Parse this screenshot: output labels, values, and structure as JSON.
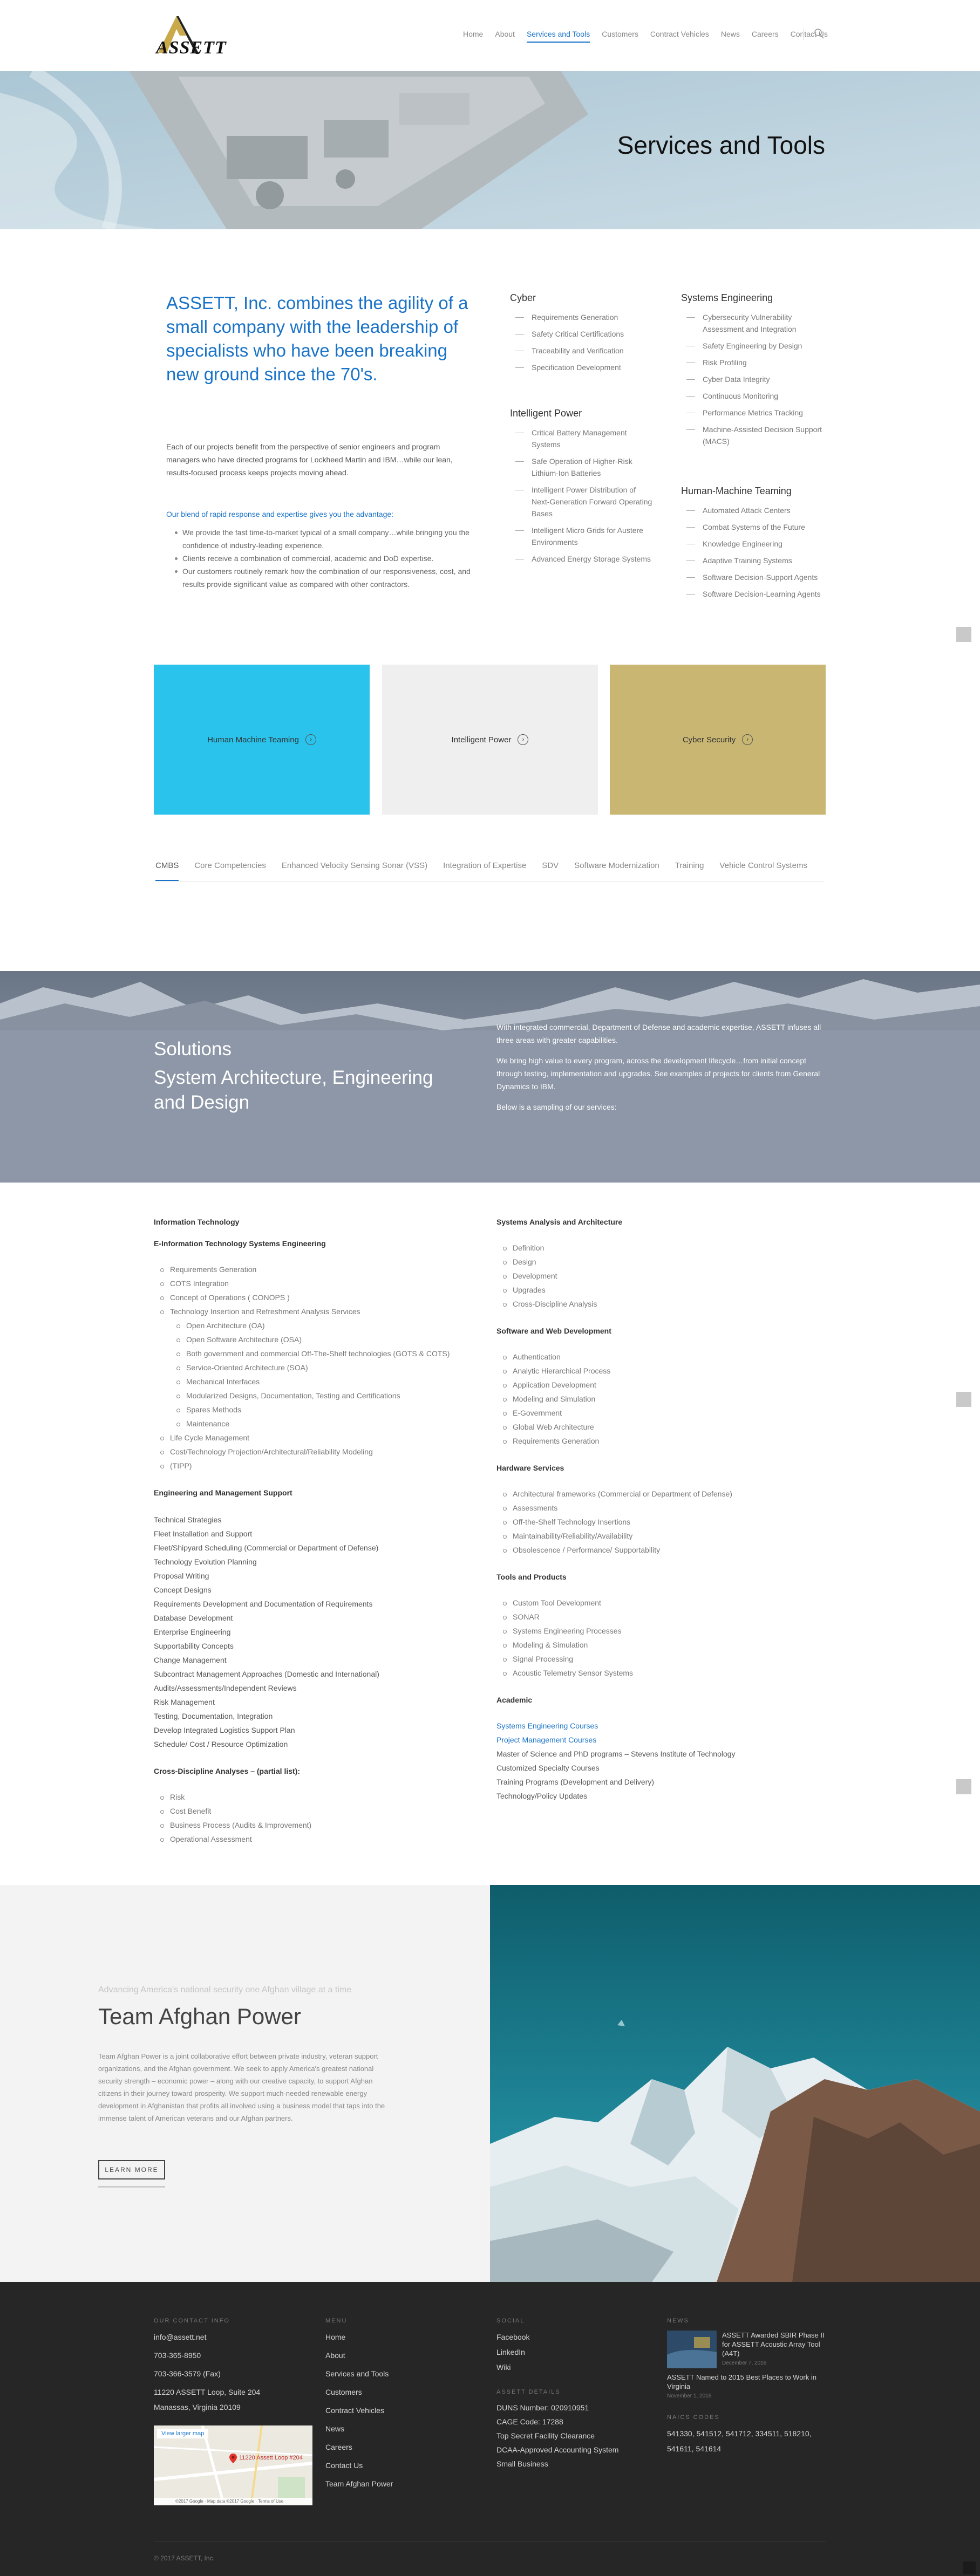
{
  "logo_text": "ASSETT",
  "nav": [
    "Home",
    "About",
    "Services and Tools",
    "Customers",
    "Contract Vehicles",
    "News",
    "Careers",
    "Contact Us"
  ],
  "hero_title": "Services and Tools",
  "intro": {
    "headline": "ASSETT, Inc. combines the agility of a small company with the leadership of specialists who have been breaking new ground since the 70's.",
    "para": "Each of our projects benefit from the perspective of senior engineers and program managers who have directed programs for Lockheed Martin and IBM…while our lean, results-focused process keeps projects moving ahead.",
    "sub": "Our blend of rapid response and expertise gives you the advantage:",
    "bullets": [
      "We provide the fast time-to-market typical of a small company…while bringing you the confidence of industry-leading experience.",
      "Clients receive a combination of commercial, academic and DoD expertise.",
      "Our customers routinely remark how the combination of our responsiveness, cost, and results provide significant value as compared with other contractors."
    ]
  },
  "services": {
    "cyber": {
      "title": "Cyber",
      "items": [
        "Requirements Generation",
        "Safety Critical Certifications",
        "Traceability and Verification",
        "Specification Development"
      ]
    },
    "power": {
      "title": "Intelligent Power",
      "items": [
        "Critical Battery Management Systems",
        "Safe Operation of Higher-Risk Lithium-Ion Batteries",
        "Intelligent Power Distribution of Next-Generation Forward Operating Bases",
        "Intelligent Micro Grids for Austere Environments",
        "Advanced Energy Storage Systems"
      ]
    },
    "systems": {
      "title": "Systems Engineering",
      "items": [
        "Cybersecurity Vulnerability Assessment and Integration",
        "Safety Engineering by Design",
        "Risk Profiling",
        "Cyber Data Integrity",
        "Continuous Monitoring",
        "Performance Metrics Tracking",
        "Machine-Assisted Decision Support (MACS)"
      ]
    },
    "hmt": {
      "title": "Human-Machine Teaming",
      "items": [
        "Automated Attack Centers",
        "Combat Systems of the Future",
        "Knowledge Engineering",
        "Adaptive Training Systems",
        "Software Decision-Support Agents",
        "Software Decision-Learning Agents"
      ]
    }
  },
  "boxes": [
    {
      "label": "Human Machine Teaming",
      "color": "#29c3ec"
    },
    {
      "label": "Intelligent Power",
      "color": "#efefef"
    },
    {
      "label": "Cyber Security",
      "color": "#c9b672"
    }
  ],
  "tabs": [
    "CMBS",
    "Core Competencies",
    "Enhanced Velocity Sensing Sonar (VSS)",
    "Integration of Expertise",
    "SDV",
    "Software Modernization",
    "Training",
    "Vehicle Control Systems"
  ],
  "solutions": {
    "title1": "Solutions",
    "title2": "System Architecture, Engineering and Design",
    "p1": "With integrated commercial, Department of Defense and academic expertise, ASSETT infuses all three areas with greater capabilities.",
    "p2": "We bring high value to every program, across the development lifecycle…from initial concept through testing, implementation and upgrades. See examples of projects for clients from General Dynamics to IBM.",
    "p3": "Below is a sampling of our services:"
  },
  "left_col": {
    "it_title": "Information Technology",
    "eit_title": "E-Information Technology Systems Engineering",
    "eit_items": [
      {
        "t": "Requirements Generation",
        "s": false
      },
      {
        "t": "COTS Integration",
        "s": false
      },
      {
        "t": "Concept of Operations ( CONOPS )",
        "s": false
      },
      {
        "t": "Technology Insertion and Refreshment Analysis Services",
        "s": false
      },
      {
        "t": "Open Architecture (OA)",
        "s": true
      },
      {
        "t": "Open Software Architecture (OSA)",
        "s": true
      },
      {
        "t": "Both government and commercial Off-The-Shelf technologies (GOTS & COTS)",
        "s": true
      },
      {
        "t": "Service-Oriented Architecture (SOA)",
        "s": true
      },
      {
        "t": "Mechanical Interfaces",
        "s": true
      },
      {
        "t": "Modularized Designs, Documentation, Testing and Certifications",
        "s": true
      },
      {
        "t": "Spares Methods",
        "s": true
      },
      {
        "t": "Maintenance",
        "s": true
      },
      {
        "t": "Life Cycle Management",
        "s": false
      },
      {
        "t": "Cost/Technology Projection/Architectural/Reliability Modeling",
        "s": false
      },
      {
        "t": "(TIPP)",
        "s": false
      }
    ],
    "ems_title": "Engineering and Management Support",
    "ems_items": [
      "Technical  Strategies",
      "Fleet Installation and Support",
      "Fleet/Shipyard Scheduling (Commercial or Department of Defense)",
      "Technology Evolution Planning",
      "Proposal Writing",
      "Concept Designs",
      "Requirements Development and Documentation of Requirements",
      "Database  Development",
      "Enterprise  Engineering",
      "Supportability  Concepts",
      "Change  Management",
      "Subcontract  Management  Approaches (Domestic and International)",
      "Audits/Assessments/Independent Reviews",
      "Risk Management",
      "Testing, Documentation, Integration",
      "Develop Integrated Logistics Support Plan",
      "Schedule/ Cost / Resource  Optimization"
    ],
    "cda_title": "Cross-Discipline Analyses – (partial list):",
    "cda_items": [
      "Risk",
      "Cost Benefit",
      "Business Process (Audits & Improvement)",
      "Operational Assessment"
    ]
  },
  "right_col": {
    "saa_title": "Systems Analysis and Architecture",
    "saa_items": [
      "Definition",
      "Design",
      "Development",
      "Upgrades",
      "Cross-Discipline Analysis"
    ],
    "swd_title": "Software and Web Development",
    "swd_items": [
      "Authentication",
      "Analytic Hierarchical Process",
      "Application Development",
      "Modeling and Simulation",
      "E-Government",
      "Global Web Architecture",
      "Requirements Generation"
    ],
    "hw_title": "Hardware Services",
    "hw_items": [
      "Architectural frameworks (Commercial or Department of Defense)",
      "Assessments",
      "Off-the-Shelf Technology Insertions",
      "Maintainability/Reliability/Availability",
      "Obsolescence / Performance/ Supportability"
    ],
    "tp_title": "Tools and Products",
    "tp_items": [
      "Custom Tool Development",
      "SONAR",
      "Systems Engineering Processes",
      "Modeling & Simulation",
      "Signal Processing",
      "Acoustic Telemetry Sensor Systems"
    ],
    "ac_title": "Academic",
    "ac_links": [
      "Systems Engineering Courses",
      "Project Management Courses"
    ],
    "ac_items": [
      "Master of Science and PhD programs – Stevens Institute of Technology",
      "Customized Specialty Courses",
      "Training Programs (Development and Delivery)",
      "Technology/Policy Updates"
    ]
  },
  "afghan": {
    "tag": "Advancing America's national security one Afghan village at a time",
    "title": "Team Afghan Power",
    "para": "Team Afghan Power is a joint collaborative effort between private industry, veteran support organizations, and the Afghan government. We seek to apply America's greatest national security strength – economic power – along with our creative capacity, to support Afghan citizens in their journey toward prosperity. We support much-needed renewable energy development in Afghanistan that profits all involved using a business model that taps into the immense talent of American veterans and our Afghan partners.",
    "button": "LEARN MORE"
  },
  "footer": {
    "contact_h": "OUR CONTACT INFO",
    "contact": [
      "info@assett.net",
      "703-365-8950",
      "703-366-3579 (Fax)",
      "11220 ASSETT Loop, Suite 204",
      "Manassas, Virginia 20109"
    ],
    "map_link": "View larger map",
    "map_pin": "11220 Assett Loop #204",
    "map_credit": "©2017 Google · Map data ©2017 Google · Terms of Use",
    "menu_h": "MENU",
    "menu": [
      "Home",
      "About",
      "Services and Tools",
      "Customers",
      "Contract Vehicles",
      "News",
      "Careers",
      "Contact Us",
      "Team Afghan Power"
    ],
    "social_h": "SOCIAL",
    "social": [
      "Facebook",
      "LinkedIn",
      "Wiki"
    ],
    "details_h": "ASSETT DETAILS",
    "details": [
      "DUNS Number: 020910951",
      "CAGE Code: 17288",
      "Top Secret Facility Clearance",
      "DCAA-Approved Accounting System",
      "Small Business"
    ],
    "news_h": "NEWS",
    "news": [
      {
        "title": "ASSETT Awarded SBIR Phase II for ASSETT Acoustic Array Tool (A4T)",
        "date": "December 7, 2016"
      },
      {
        "title": "ASSETT Named to 2015 Best Places to Work in Virginia",
        "date": "November 1, 2016"
      }
    ],
    "naics_h": "NAICS CODES",
    "naics": "541330, 541512, 541712, 334511, 518210, 541611, 541614",
    "copyright": "© 2017 ASSETT, Inc."
  }
}
